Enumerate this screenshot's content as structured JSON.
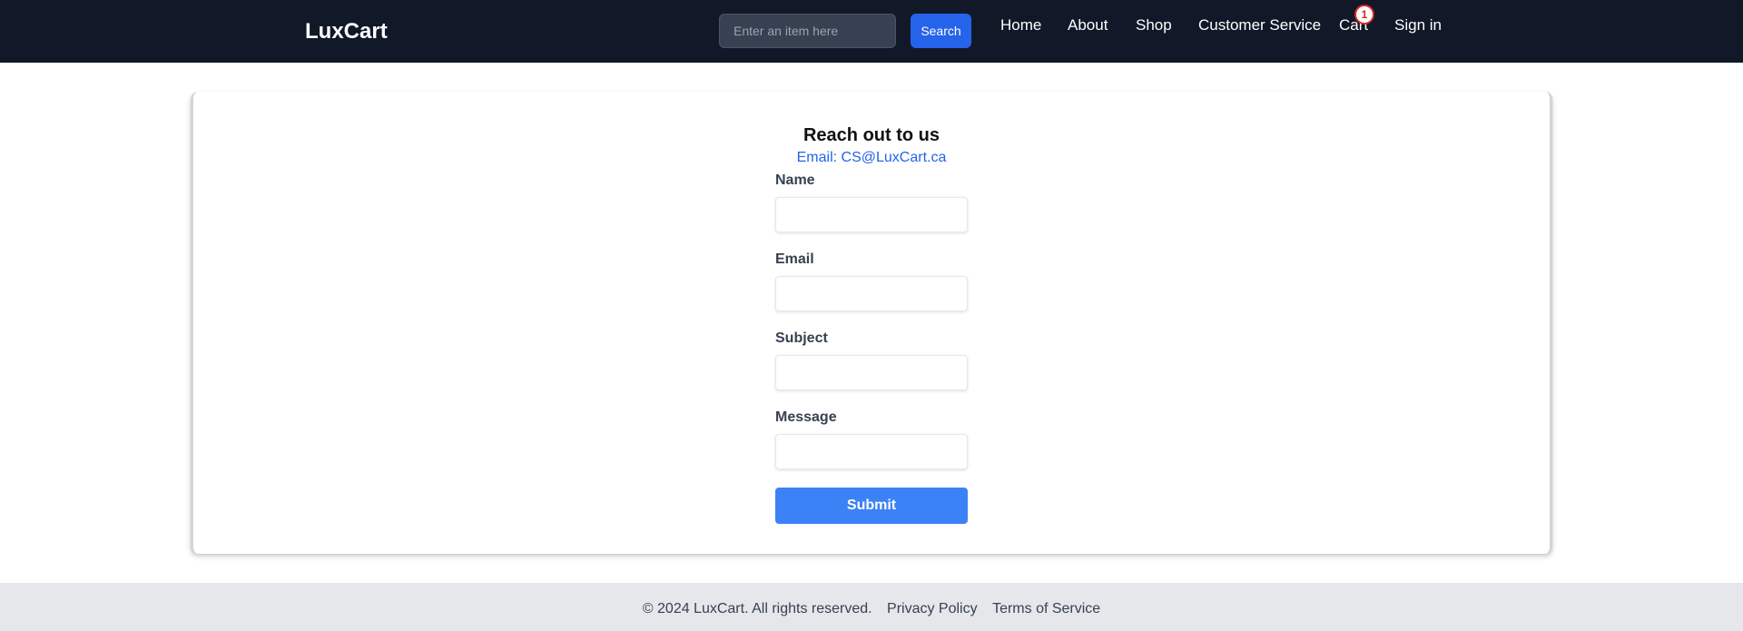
{
  "header": {
    "brand": "LuxCart",
    "search": {
      "placeholder": "Enter an item here",
      "button_label": "Search"
    },
    "nav": {
      "home": "Home",
      "about": "About",
      "shop": "Shop",
      "customer_service": "Customer Service",
      "cart": "Cart",
      "sign_in": "Sign in"
    },
    "cart_count": "1"
  },
  "contact": {
    "title": "Reach out to us",
    "email_text": "Email: CS@LuxCart.ca",
    "fields": {
      "name": {
        "label": "Name",
        "value": ""
      },
      "email": {
        "label": "Email",
        "value": ""
      },
      "subject": {
        "label": "Subject",
        "value": ""
      },
      "message": {
        "label": "Message",
        "value": ""
      }
    },
    "submit_label": "Submit"
  },
  "footer": {
    "copyright": "© 2024 LuxCart. All rights reserved.",
    "privacy": "Privacy Policy",
    "terms": "Terms of Service"
  },
  "colors": {
    "navbar_bg": "#111827",
    "primary": "#2563eb",
    "submit": "#3b82f6",
    "badge": "#dc2626",
    "footer_bg": "#e5e7eb"
  }
}
